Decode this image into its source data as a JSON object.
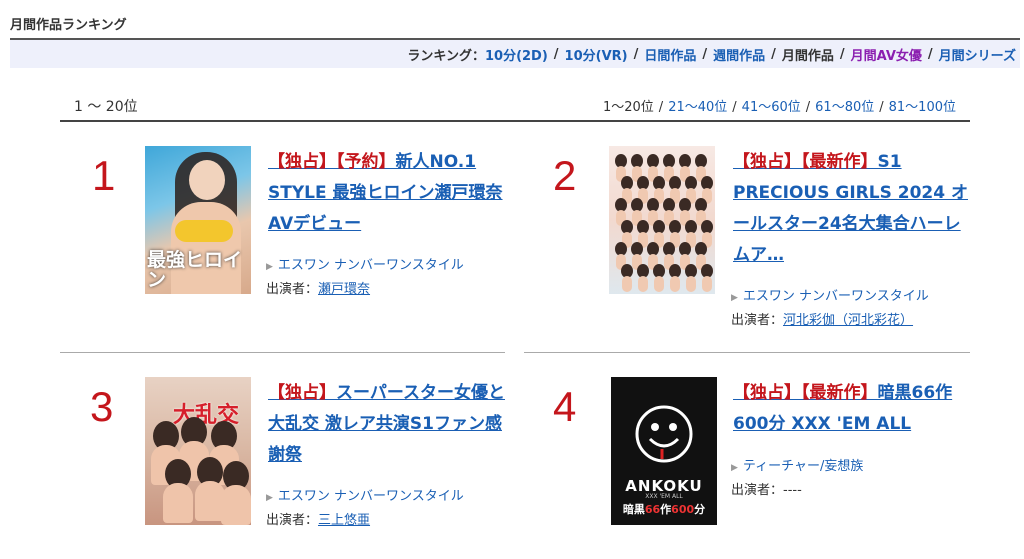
{
  "section_title": "月間作品ランキング",
  "ranking_nav": {
    "label": "ランキング：",
    "links": [
      {
        "label": "10分(2D)",
        "style": "link"
      },
      {
        "label": "10分(VR)",
        "style": "link"
      },
      {
        "label": "日間作品",
        "style": "link"
      },
      {
        "label": "週間作品",
        "style": "link"
      },
      {
        "label": "月間作品",
        "style": "current"
      },
      {
        "label": "月間AV女優",
        "style": "purple"
      },
      {
        "label": "月間シリーズ",
        "style": "link"
      }
    ],
    "separator": "/"
  },
  "range": {
    "current": "1 〜 20位",
    "links": [
      "1〜20位",
      "21〜40位",
      "41〜60位",
      "61〜80位",
      "81〜100位"
    ]
  },
  "items": [
    {
      "rank": "1",
      "tags": [
        "【独占】",
        "【予約】"
      ],
      "title": "新人NO.1 STYLE 最強ヒロイン瀬戸環奈AVデビュー",
      "maker": "エスワン ナンバーワンスタイル",
      "performer_label": "出演者：",
      "performer": "瀬戸環奈",
      "thumb_text": "最強ヒロイン"
    },
    {
      "rank": "2",
      "tags": [
        "【独占】",
        "【最新作】"
      ],
      "title": "S1 PRECIOUS GIRLS 2024 オールスター24名大集合ハーレムア…",
      "maker": "エスワン ナンバーワンスタイル",
      "performer_label": "出演者：",
      "performer": "河北彩伽（河北彩花）"
    },
    {
      "rank": "3",
      "tags": [
        "【独占】"
      ],
      "title": "スーパースター女優と大乱交 激レア共演S1ファン感謝祭",
      "maker": "エスワン ナンバーワンスタイル",
      "performer_label": "出演者：",
      "performer": "三上悠亜",
      "thumb_text": "大乱交"
    },
    {
      "rank": "4",
      "tags": [
        "【独占】",
        "【最新作】"
      ],
      "title": "暗黒66作600分 XXX 'EM ALL",
      "maker": "ティーチャー/妄想族",
      "performer_label": "出演者：",
      "performer": "----",
      "thumb_logo": "ANKOKU",
      "thumb_sub": "XXX 'EM ALL",
      "thumb_bottom_a": "暗黒",
      "thumb_bottom_b": "66",
      "thumb_bottom_c": "作",
      "thumb_bottom_d": "600",
      "thumb_bottom_e": "分"
    }
  ],
  "colors": {
    "accent_link": "#1a5fb4",
    "rank_red": "#c4161c",
    "nav_bg": "#eef0fb",
    "purple_link": "#8b1fb0"
  }
}
